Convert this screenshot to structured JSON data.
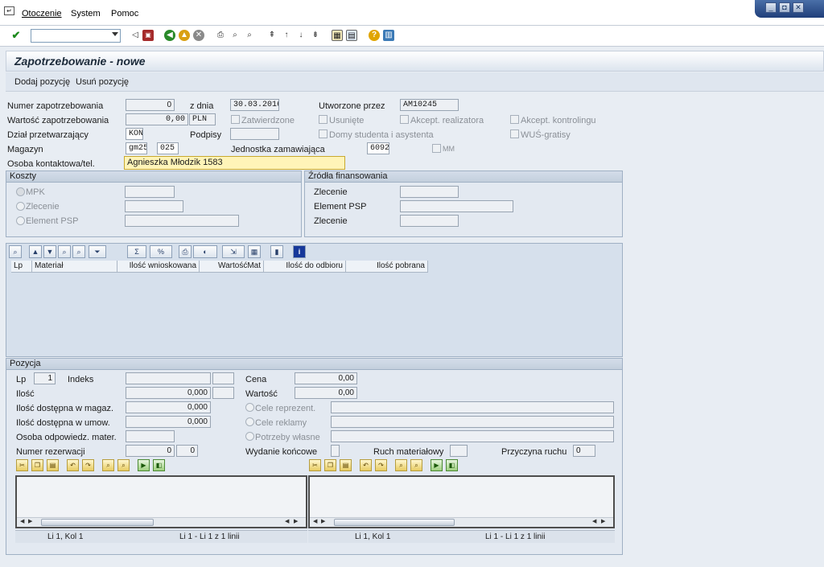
{
  "menu": {
    "items": [
      "Otoczenie",
      "System",
      "Pomoc"
    ]
  },
  "window": {
    "minimize": "_",
    "restore": "◘",
    "close": "✕"
  },
  "toolbar": {
    "command_value": ""
  },
  "title": "Zapotrzebowanie - nowe",
  "app_toolbar": {
    "add": "Dodaj pozycję",
    "remove": "Usuń pozycję"
  },
  "header": {
    "numer_label": "Numer zapotrzebowania",
    "numer_value": "0",
    "zdnia_label": "z dnia",
    "zdnia_value": "30.03.2016",
    "utworzone_label": "Utworzone przez",
    "utworzone_value": "AM10245",
    "wartosc_label": "Wartość zapotrzebowania",
    "wartosc_value": "0,00",
    "waluta_value": "PLN",
    "zatwierdzone_label": "Zatwierdzone",
    "usuniete_label": "Usunięte",
    "akcept_realizatora_label": "Akcept. realizatora",
    "akcept_kontrolingu_label": "Akcept. kontrolingu",
    "dzial_label": "Dział przetwarzający",
    "dzial_value": "KON",
    "podpisy_label": "Podpisy",
    "podpisy_value": "",
    "domy_label": "Domy studenta i asystenta",
    "wus_label": "WUŚ-gratisy",
    "magazyn_label": "Magazyn",
    "magazyn_value1": "gm25",
    "magazyn_value2": "025",
    "jednostka_label": "Jednostka zamawiająca",
    "jednostka_value": "6092",
    "mm_label": "MM",
    "osoba_label": "Osoba kontaktowa/tel.",
    "osoba_value": "Agnieszka Młodzik 1583"
  },
  "koszty": {
    "title": "Koszty",
    "mpk_label": "MPK",
    "zlecenie_label": "Zlecenie",
    "element_label": "Element PSP"
  },
  "zrodla": {
    "title": "Źródła finansowania",
    "zlecenie1_label": "Zlecenie",
    "element_label": "Element PSP",
    "zlecenie2_label": "Zlecenie"
  },
  "grid": {
    "columns": [
      "Lp",
      "Materiał",
      "Ilość wnioskowana",
      "WartośćMat",
      "Ilość do odbioru",
      "Ilość pobrana"
    ]
  },
  "pozycja": {
    "title": "Pozycja",
    "lp_label": "Lp",
    "lp_value": "1",
    "indeks_label": "Indeks",
    "cena_label": "Cena",
    "cena_value": "0,00",
    "ilosc_label": "Ilość",
    "ilosc_value": "0,000",
    "wartosc_label": "Wartość",
    "wartosc_value": "0,00",
    "dostepna_magaz_label": "Ilość dostępna w magaz.",
    "dostepna_magaz_value": "0,000",
    "cele_reprezent_label": "Cele reprezent.",
    "dostepna_umow_label": "Ilość dostępna w umow.",
    "dostepna_umow_value": "0,000",
    "cele_reklamy_label": "Cele reklamy",
    "osoba_odp_label": "Osoba odpowiedz. mater.",
    "potrzeby_label": "Potrzeby własne",
    "numer_rez_label": "Numer rezerwacji",
    "numer_rez_value1": "0",
    "numer_rez_value2": "0",
    "wydanie_label": "Wydanie końcowe",
    "ruch_label": "Ruch materiałowy",
    "przyczyna_label": "Przyczyna ruchu",
    "przyczyna_value": "0"
  },
  "editors": {
    "left_status_pos": "Li 1, Kol 1",
    "left_status_lines": "Li 1 - Li 1 z 1 linii",
    "right_status_pos": "Li 1, Kol 1",
    "right_status_lines": "Li 1 - Li 1 z 1 linii"
  }
}
